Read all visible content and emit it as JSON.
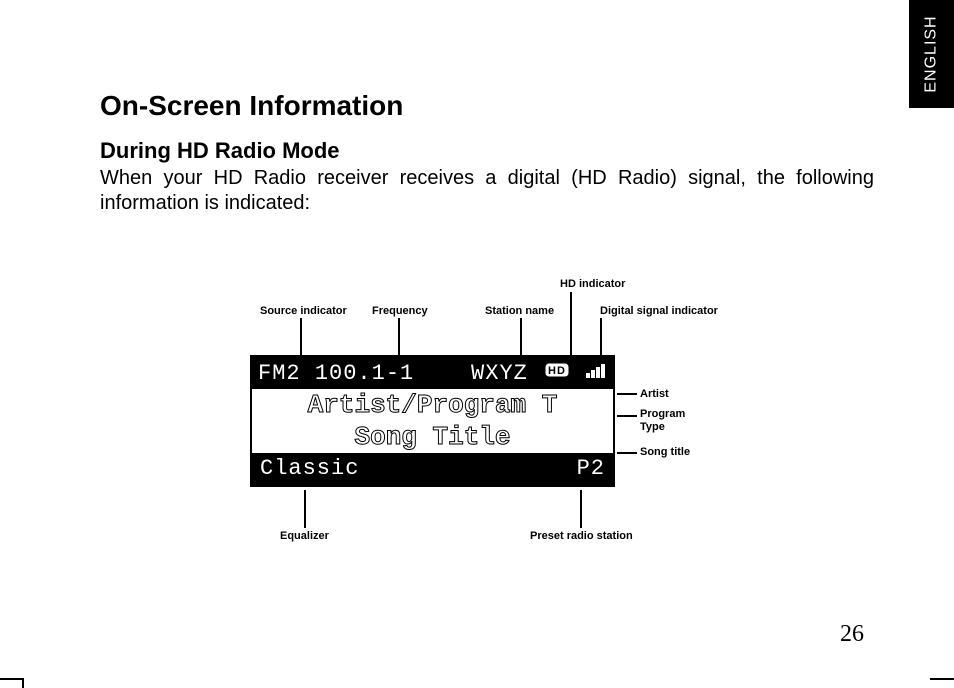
{
  "language_tab": "ENGLISH",
  "title": "On-Screen Information",
  "subtitle": "During HD Radio Mode",
  "intro": "When your HD Radio receiver receives a digital (HD Radio) signal, the following information is indicated:",
  "labels": {
    "source_indicator": "Source indicator",
    "frequency": "Frequency",
    "station_name": "Station name",
    "hd_indicator": "HD indicator",
    "digital_signal_indicator": "Digital signal indicator",
    "artist": "Artist",
    "program_type": "Program Type",
    "song_title": "Song title",
    "equalizer": "Equalizer",
    "preset": "Preset radio station"
  },
  "display": {
    "top_source": "FM2",
    "top_freq": "100.1-1",
    "top_station": "WXYZ",
    "line_artist": "Artist/Program T",
    "line_song": "Song Title",
    "eq": "Classic",
    "preset": "P2"
  },
  "page_number": "26"
}
